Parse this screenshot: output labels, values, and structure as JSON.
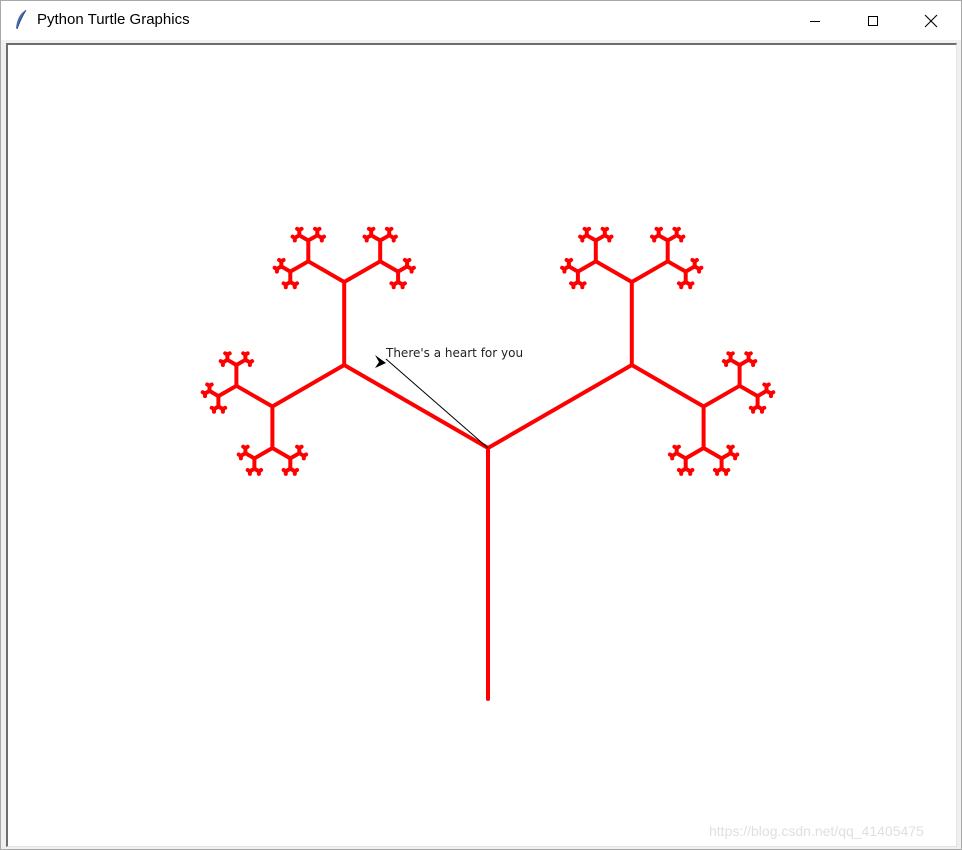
{
  "window": {
    "title": "Python Turtle Graphics",
    "icon": "feather-icon",
    "controls": [
      "minimize-icon",
      "maximize-icon",
      "close-icon"
    ]
  },
  "canvas": {
    "background_color": "#ffffff",
    "pen_color": "#ff0000",
    "message": "There's a heart for you",
    "turtle_color": "#000000"
  },
  "watermark": "https://blog.csdn.net/qq_41405475"
}
